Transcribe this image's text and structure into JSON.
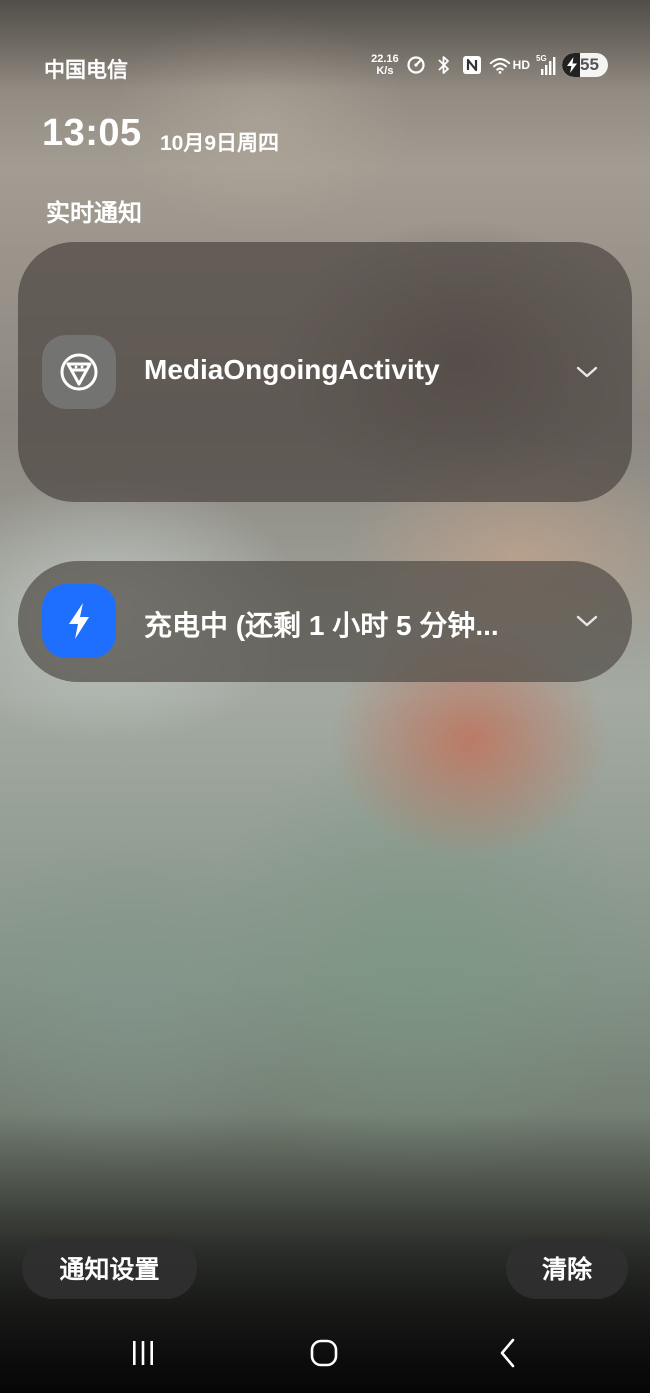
{
  "status_bar": {
    "carrier": "中国电信",
    "net_speed_value": "22.16",
    "net_speed_unit": "K/s",
    "hd_label": "HD",
    "network_type": "5G",
    "battery_level": "55",
    "icons": [
      "speedometer-icon",
      "bluetooth-icon",
      "nfc-icon",
      "wifi-icon",
      "signal-icon",
      "battery-charging-icon"
    ]
  },
  "header": {
    "time": "13:05",
    "date": "10月9日周四"
  },
  "section": {
    "title": "实时通知"
  },
  "notifications": [
    {
      "app_icon": "media-app-icon",
      "title": "MediaOngoingActivity",
      "icon_bg": "#737371"
    },
    {
      "app_icon": "lightning-icon",
      "title": "充电中 (还剩 1 小时 5 分钟...",
      "icon_bg": "#1f6fff"
    }
  ],
  "actions": {
    "settings_label": "通知设置",
    "clear_label": "清除"
  },
  "nav_bar": {
    "buttons": [
      "recent-apps",
      "home",
      "back"
    ]
  }
}
